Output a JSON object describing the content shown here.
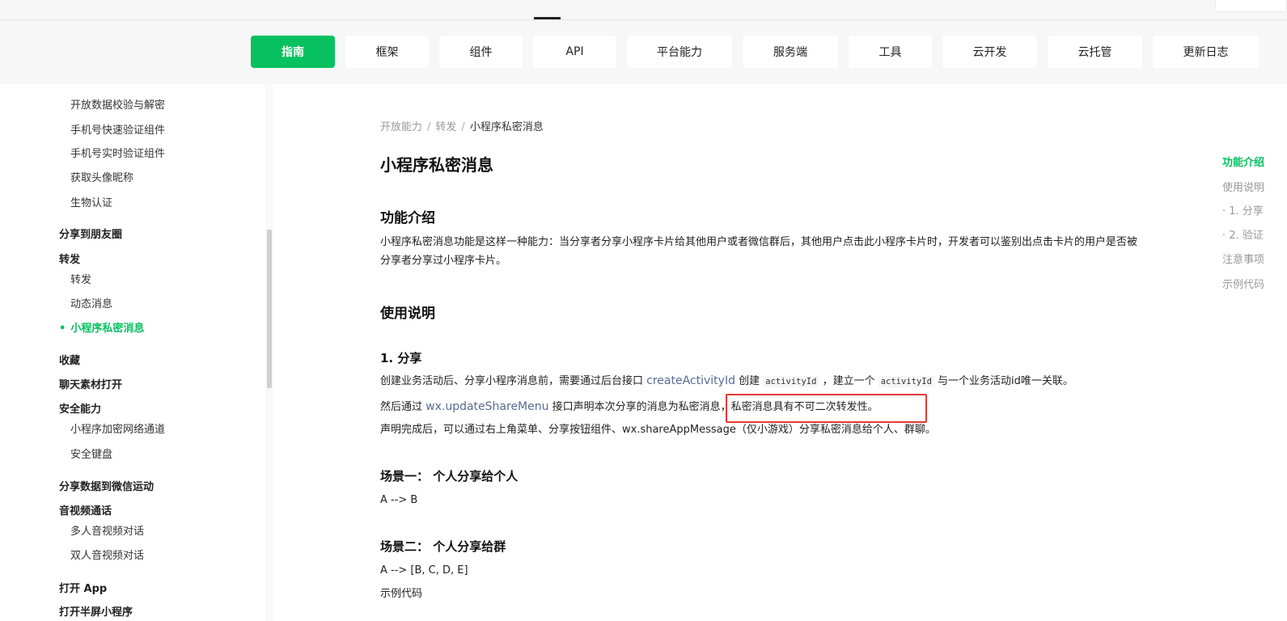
{
  "header": {
    "tabs": [
      {
        "label": "指南",
        "active": true
      },
      {
        "label": "框架"
      },
      {
        "label": "组件"
      },
      {
        "label": "API"
      },
      {
        "label": "平台能力"
      },
      {
        "label": "服务端"
      },
      {
        "label": "工具"
      },
      {
        "label": "云开发"
      },
      {
        "label": "云托管"
      },
      {
        "label": "更新日志"
      }
    ]
  },
  "sidebar": {
    "items": [
      {
        "label": "开放数据校验与解密"
      },
      {
        "label": "手机号快速验证组件"
      },
      {
        "label": "手机号实时验证组件"
      },
      {
        "label": "获取头像昵称"
      },
      {
        "label": "生物认证"
      },
      {
        "label": "分享到朋友圈"
      },
      {
        "label": "转发"
      },
      {
        "label": "转发"
      },
      {
        "label": "动态消息"
      },
      {
        "label": "小程序私密消息"
      },
      {
        "label": "收藏"
      },
      {
        "label": "聊天素材打开"
      },
      {
        "label": "安全能力"
      },
      {
        "label": "小程序加密网络通道"
      },
      {
        "label": "安全键盘"
      },
      {
        "label": "分享数据到微信运动"
      },
      {
        "label": "音视频通话"
      },
      {
        "label": "多人音视频对话"
      },
      {
        "label": "双人音视频对话"
      },
      {
        "label": "打开 App"
      },
      {
        "label": "打开半屏小程序"
      }
    ]
  },
  "breadcrumb": {
    "items": [
      "开放能力",
      "转发",
      "小程序私密消息"
    ],
    "separator": "/"
  },
  "article": {
    "title": "小程序私密消息",
    "section1_title": "功能介绍",
    "section1_text": "小程序私密消息功能是这样一种能力：当分享者分享小程序卡片给其他用户或者微信群后，其他用户点击此小程序卡片时，开发者可以鉴别出点击卡片的用户是否被分享者分享过小程序卡片。",
    "section2_title": "使用说明",
    "sub1_title": "1. 分享",
    "line1_a": "创建业务活动后、分享小程序消息前，需要通过后台接口 ",
    "line1_link": "createActivityId",
    "line1_b": " 创建 ",
    "line1_code1": "activityId",
    "line1_c": " ，建立一个 ",
    "line1_code2": "activityId",
    "line1_d": " 与一个业务活动id唯一关联。",
    "line2_a": "然后通过 ",
    "line2_link": "wx.updateShareMenu",
    "line2_b": " 接口声明本次分享的消息为私密消息，私密消息具有不可二次转发性。",
    "line3": "声明完成后，可以通过右上角菜单、分享按钮组件、wx.shareAppMessage（仅小游戏）分享私密消息给个人、群聊。",
    "scene1_title": "场景一： 个人分享给个人",
    "scene1_text": "A --> B",
    "scene2_title": "场景二： 个人分享给群",
    "scene2_text": "A --> [B, C, D, E]",
    "example_label": "示例代码"
  },
  "toc": {
    "items": [
      {
        "label": "功能介绍",
        "active": true
      },
      {
        "label": "使用说明"
      },
      {
        "label": "· 1. 分享"
      },
      {
        "label": "· 2. 验证"
      },
      {
        "label": "注意事项"
      },
      {
        "label": "示例代码"
      }
    ]
  },
  "colors": {
    "accent": "#07c160",
    "link": "#576b95",
    "highlight": "#e53935"
  }
}
